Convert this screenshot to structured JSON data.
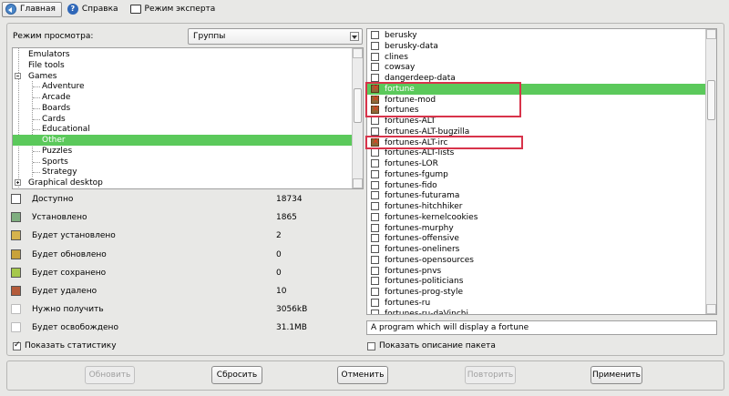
{
  "toolbar": {
    "home": "Главная",
    "help": "Справка",
    "expert": "Режим эксперта"
  },
  "view": {
    "label": "Режим просмотра:",
    "selected": "Группы"
  },
  "tree": [
    {
      "label": "Emulators",
      "level": 1
    },
    {
      "label": "File tools",
      "level": 1
    },
    {
      "label": "Games",
      "level": 1,
      "expander": "minus"
    },
    {
      "label": "Adventure",
      "level": 2
    },
    {
      "label": "Arcade",
      "level": 2
    },
    {
      "label": "Boards",
      "level": 2
    },
    {
      "label": "Cards",
      "level": 2
    },
    {
      "label": "Educational",
      "level": 2
    },
    {
      "label": "Other",
      "level": 2,
      "selected": true
    },
    {
      "label": "Puzzles",
      "level": 2
    },
    {
      "label": "Sports",
      "level": 2
    },
    {
      "label": "Strategy",
      "level": 2
    },
    {
      "label": "Graphical desktop",
      "level": 1,
      "expander": "plus"
    }
  ],
  "stats": [
    {
      "icon": "available-icon",
      "label": "Доступно",
      "value": "18734"
    },
    {
      "icon": "installed-icon",
      "label": "Установлено",
      "value": "1865"
    },
    {
      "icon": "to-install-icon",
      "label": "Будет установлено",
      "value": "2"
    },
    {
      "icon": "to-update-icon",
      "label": "Будет обновлено",
      "value": "0"
    },
    {
      "icon": "to-keep-icon",
      "label": "Будет сохранено",
      "value": "0"
    },
    {
      "icon": "to-remove-icon",
      "label": "Будет удалено",
      "value": "10"
    },
    {
      "icon": "download-icon",
      "label": "Нужно получить",
      "value": "3056kB"
    },
    {
      "icon": "free-icon",
      "label": "Будет освобождено",
      "value": "31.1MB"
    }
  ],
  "show_stats": {
    "label": "Показать статистику",
    "checked": true
  },
  "packages": [
    {
      "name": "berusky",
      "state": "none"
    },
    {
      "name": "berusky-data",
      "state": "none"
    },
    {
      "name": "clines",
      "state": "none"
    },
    {
      "name": "cowsay",
      "state": "none"
    },
    {
      "name": "dangerdeep-data",
      "state": "none"
    },
    {
      "name": "fortune",
      "state": "remove",
      "selected": true
    },
    {
      "name": "fortune-mod",
      "state": "remove"
    },
    {
      "name": "fortunes",
      "state": "remove"
    },
    {
      "name": "fortunes-ALT",
      "state": "none"
    },
    {
      "name": "fortunes-ALT-bugzilla",
      "state": "none"
    },
    {
      "name": "fortunes-ALT-irc",
      "state": "remove"
    },
    {
      "name": "fortunes-ALT-lists",
      "state": "none"
    },
    {
      "name": "fortunes-LOR",
      "state": "none"
    },
    {
      "name": "fortunes-fgump",
      "state": "none"
    },
    {
      "name": "fortunes-fido",
      "state": "none"
    },
    {
      "name": "fortunes-futurama",
      "state": "none"
    },
    {
      "name": "fortunes-hitchhiker",
      "state": "none"
    },
    {
      "name": "fortunes-kernelcookies",
      "state": "none"
    },
    {
      "name": "fortunes-murphy",
      "state": "none"
    },
    {
      "name": "fortunes-offensive",
      "state": "none"
    },
    {
      "name": "fortunes-oneliners",
      "state": "none"
    },
    {
      "name": "fortunes-opensources",
      "state": "none"
    },
    {
      "name": "fortunes-pnvs",
      "state": "none"
    },
    {
      "name": "fortunes-politicians",
      "state": "none"
    },
    {
      "name": "fortunes-prog-style",
      "state": "none"
    },
    {
      "name": "fortunes-ru",
      "state": "none"
    },
    {
      "name": "fortunes-ru-daVinchi",
      "state": "none"
    }
  ],
  "description": "A program which will display a fortune",
  "show_desc": {
    "label": "Показать описание пакета",
    "checked": false
  },
  "buttons": {
    "update": "Обновить",
    "reset": "Сбросить",
    "cancel": "Отменить",
    "repeat": "Повторить",
    "apply": "Применить"
  },
  "colors": {
    "selection": "#5bc95b",
    "highlight_box": "#d8334a"
  }
}
